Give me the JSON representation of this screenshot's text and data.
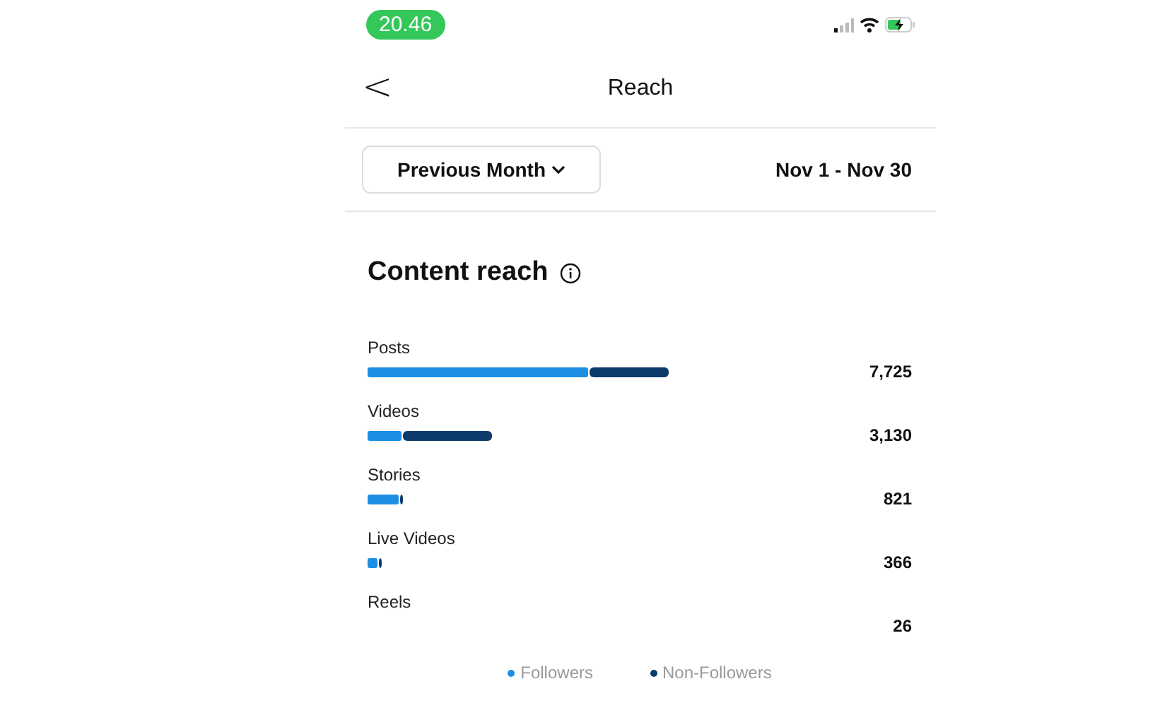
{
  "status_bar": {
    "time": "20.46"
  },
  "header": {
    "back": "<",
    "title": "Reach"
  },
  "filter": {
    "period": "Previous Month",
    "range": "Nov 1 - Nov 30"
  },
  "content_reach": {
    "title": "Content reach",
    "rows": [
      {
        "label": "Posts",
        "value": "7,725"
      },
      {
        "label": "Videos",
        "value": "3,130"
      },
      {
        "label": "Stories",
        "value": "821"
      },
      {
        "label": "Live Videos",
        "value": "366"
      },
      {
        "label": "Reels",
        "value": "26"
      }
    ],
    "legend": [
      {
        "label": "Followers",
        "color": "#1c8fe3"
      },
      {
        "label": "Non-Followers",
        "color": "#0c3a6b"
      }
    ]
  }
}
